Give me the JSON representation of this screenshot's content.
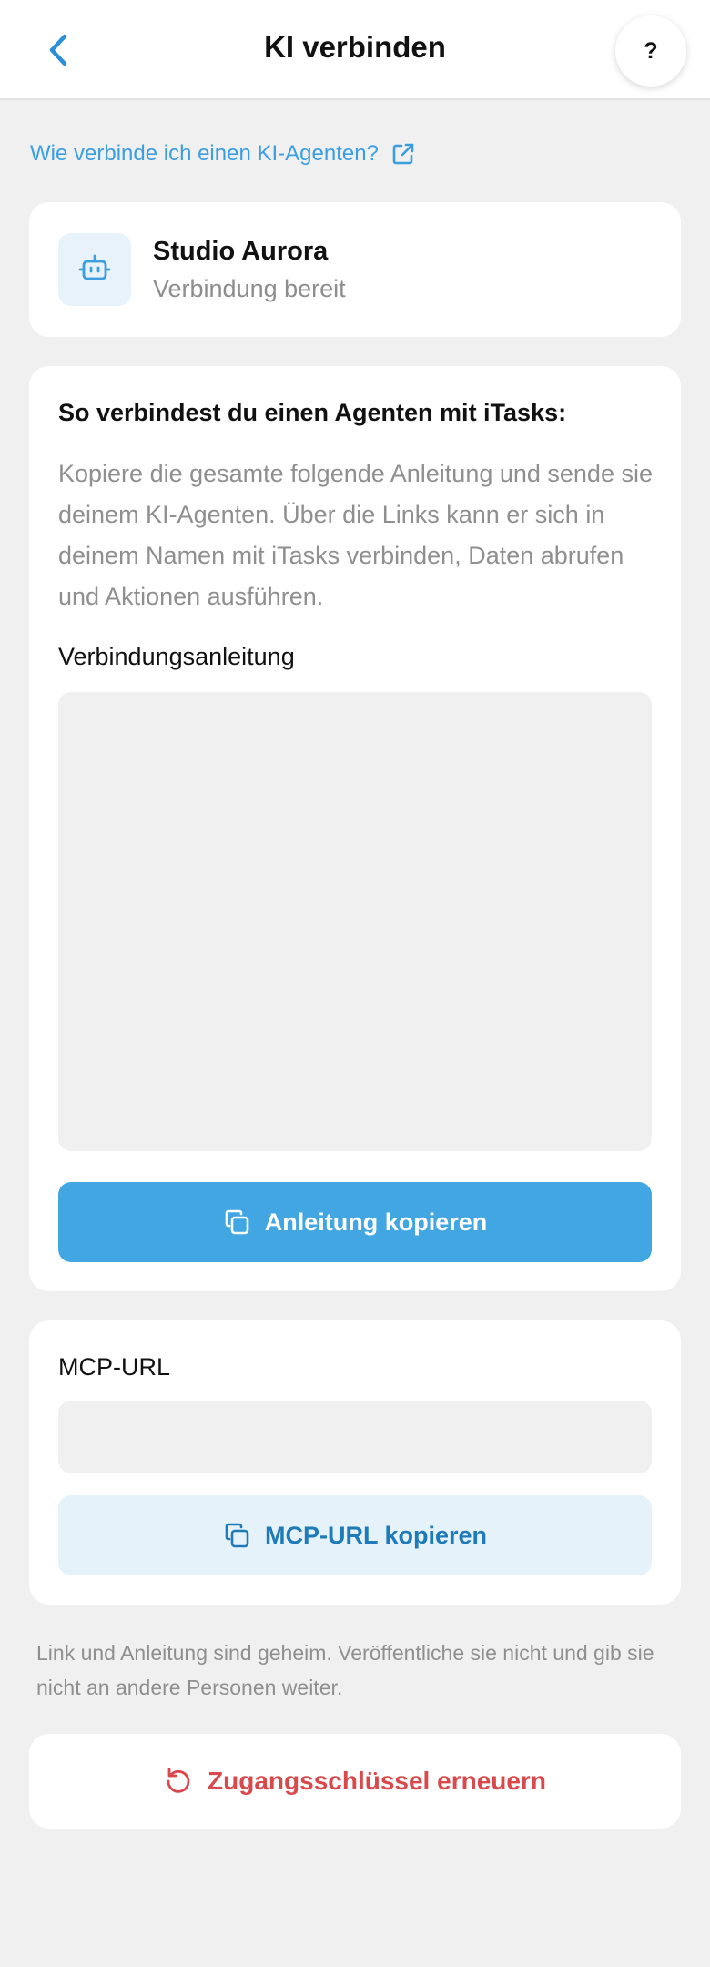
{
  "header": {
    "title": "KI verbinden",
    "back_icon": "chevron-left-icon",
    "help_label": "?"
  },
  "help_link": {
    "label": "Wie verbinde ich einen KI-Agenten?",
    "icon": "external-link-icon"
  },
  "agent": {
    "name": "Studio Aurora",
    "status": "Verbindung bereit",
    "icon": "robot-icon"
  },
  "instructions": {
    "heading": "So verbindest du einen Agenten mit iTasks:",
    "description": "Kopiere die gesamte folgende Anleitung und sende sie deinem KI-Agenten. Über die Links kann er sich in deinem Namen mit iTasks verbinden, Daten abrufen und Aktionen ausführen.",
    "field_label": "Verbindungsanleitung",
    "field_value": "",
    "copy_button": "Anleitung kopieren"
  },
  "mcp": {
    "label": "MCP-URL",
    "value": "",
    "copy_button": "MCP-URL kopieren"
  },
  "secret_note": "Link und Anleitung sind geheim. Veröffentliche sie nicht und gib sie nicht an andere Personen weiter.",
  "renew_button": "Zugangsschlüssel erneuern",
  "colors": {
    "accent": "#42a6e3",
    "link": "#3a9ee0",
    "danger": "#d9494c",
    "background": "#f0f0f0"
  }
}
